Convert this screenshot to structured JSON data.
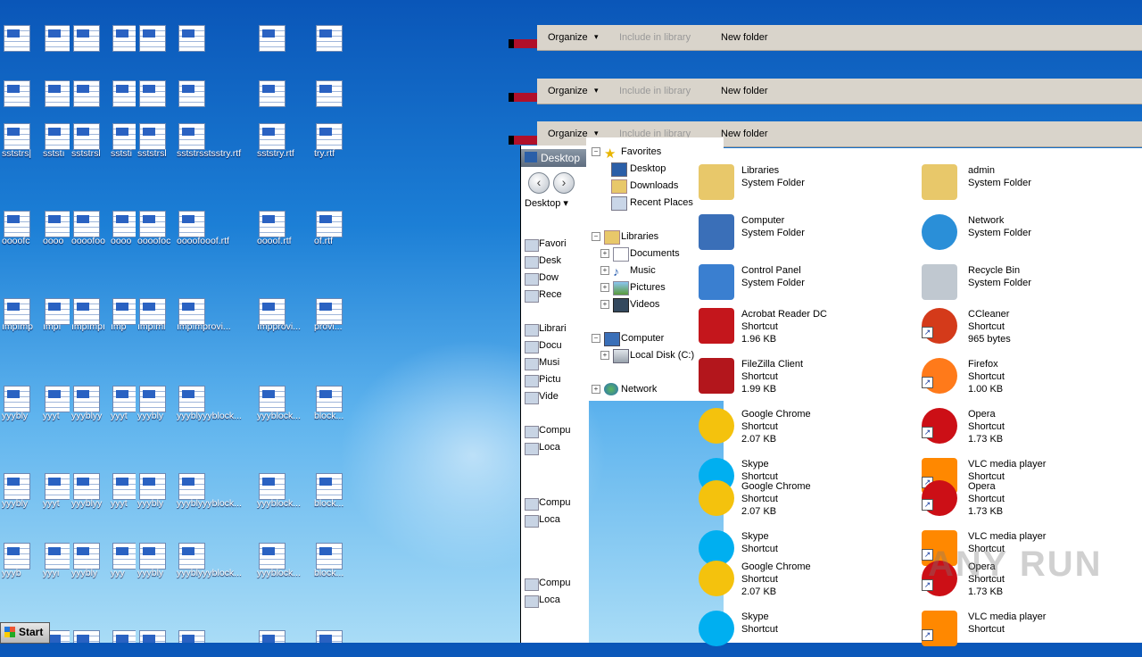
{
  "desktop": {
    "columns": [
      {
        "labels": [
          "sststrs|",
          "oooofc",
          "ımpımp",
          "yyybly",
          "yyybly",
          "yyyb"
        ]
      },
      {
        "labels": [
          "sststı",
          "oooo",
          "ımpı",
          "yyyt",
          "yyyt",
          "yyyı"
        ]
      },
      {
        "labels": [
          "sststrsl",
          "oooofoo",
          "ımpımpı",
          "yyyblyy",
          "yyyblyy",
          "yyybly"
        ]
      },
      {
        "labels": [
          "sststi",
          "oooo",
          "ımp",
          "yyyt",
          "yyyt",
          "yyy"
        ]
      },
      {
        "labels": [
          "sststrsl",
          "oooofoc",
          "ımpıml",
          "yyybly",
          "yyybly",
          "yyybly"
        ]
      },
      {
        "labels": [
          "sststrsstsstry.rtf",
          "oooofooof.rtf",
          "ımpımprovi...",
          "yyyblyyyblock...",
          "yyyblyyyblock...",
          "yyyblyyyblock..."
        ]
      },
      {
        "labels": [
          "sststry.rtf",
          "oooof.rtf",
          "ımpprovi...",
          "yyyblock...",
          "yyyblock...",
          "yyyblock..."
        ]
      },
      {
        "labels": [
          "try.rtf",
          "of.rtf",
          "provi...",
          "block...",
          "block...",
          "block..."
        ]
      }
    ]
  },
  "toolbar": {
    "organize": "Organize",
    "include": "Include in library",
    "new_folder": "New folder"
  },
  "back_window": {
    "title": "Desktop",
    "address": "Desktop",
    "items": [
      "Favori",
      "Desk",
      "Dow",
      "Rece",
      "Librari",
      "Docu",
      "Musi",
      "Pictu",
      "Vide",
      "Compu",
      "Loca",
      "Compu",
      "Loca",
      "Compu",
      "Loca"
    ]
  },
  "nav_pane": {
    "favorites": "Favorites",
    "desktop": "Desktop",
    "downloads": "Downloads",
    "recent": "Recent Places",
    "libraries": "Libraries",
    "documents": "Documents",
    "music": "Music",
    "pictures": "Pictures",
    "videos": "Videos",
    "computer": "Computer",
    "local_disk": "Local Disk (C:)",
    "network": "Network"
  },
  "content": {
    "left": [
      {
        "name": "Libraries",
        "type": "System Folder",
        "size": ""
      },
      {
        "name": "Computer",
        "type": "System Folder",
        "size": ""
      },
      {
        "name": "Control Panel",
        "type": "System Folder",
        "size": ""
      },
      {
        "name": "Acrobat Reader DC",
        "type": "Shortcut",
        "size": "1.96 KB"
      },
      {
        "name": "FileZilla Client",
        "type": "Shortcut",
        "size": "1.99 KB"
      },
      {
        "name": "Google Chrome",
        "type": "Shortcut",
        "size": "2.07 KB"
      },
      {
        "name": "Skype",
        "type": "Shortcut",
        "size": ""
      },
      {
        "name": "Google Chrome",
        "type": "Shortcut",
        "size": "2.07 KB"
      },
      {
        "name": "Skype",
        "type": "Shortcut",
        "size": ""
      },
      {
        "name": "Google Chrome",
        "type": "Shortcut",
        "size": "2.07 KB"
      },
      {
        "name": "Skype",
        "type": "Shortcut",
        "size": ""
      }
    ],
    "right": [
      {
        "name": "admin",
        "type": "System Folder",
        "size": ""
      },
      {
        "name": "Network",
        "type": "System Folder",
        "size": ""
      },
      {
        "name": "Recycle Bin",
        "type": "System Folder",
        "size": ""
      },
      {
        "name": "CCleaner",
        "type": "Shortcut",
        "size": "965 bytes"
      },
      {
        "name": "Firefox",
        "type": "Shortcut",
        "size": "1.00 KB"
      },
      {
        "name": "Opera",
        "type": "Shortcut",
        "size": "1.73 KB"
      },
      {
        "name": "VLC media player",
        "type": "Shortcut",
        "size": ""
      },
      {
        "name": "Opera",
        "type": "Shortcut",
        "size": "1.73 KB"
      },
      {
        "name": "VLC media player",
        "type": "Shortcut",
        "size": ""
      },
      {
        "name": "Opera",
        "type": "Shortcut",
        "size": "1.73 KB"
      },
      {
        "name": "VLC media player",
        "type": "Shortcut",
        "size": ""
      }
    ]
  },
  "watermark": "ANY RUN",
  "taskbar": {
    "start": "Start"
  }
}
